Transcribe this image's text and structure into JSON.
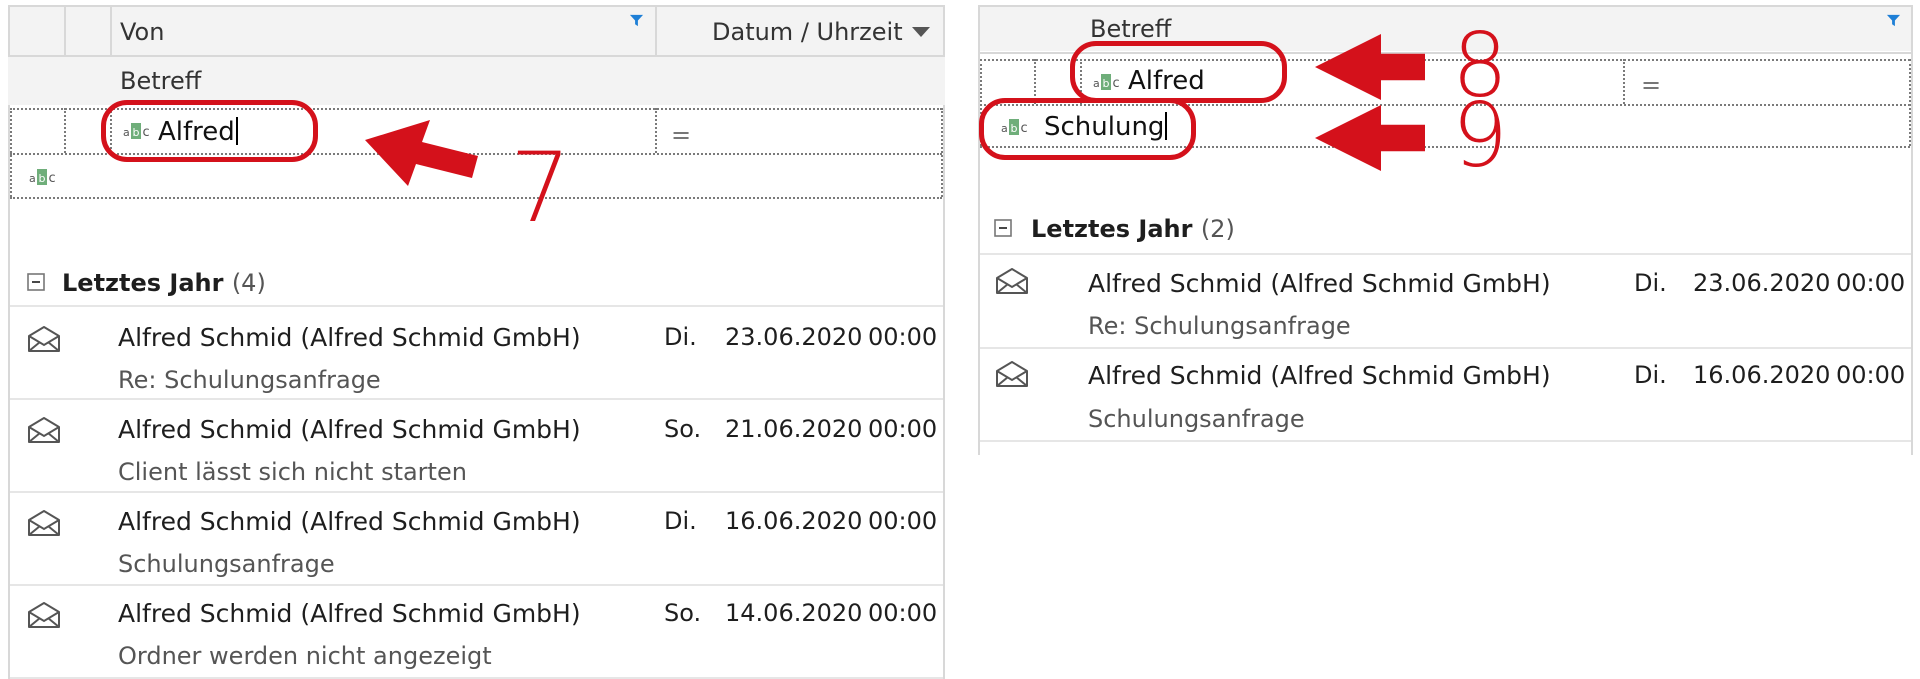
{
  "left": {
    "columns": {
      "from": "Von",
      "date": "Datum / Uhrzeit",
      "subject": "Betreff"
    },
    "filter": {
      "value": "Alfred",
      "operator": "="
    },
    "group": {
      "label": "Letztes Jahr",
      "count": "(4)"
    },
    "rows": [
      {
        "sender": "Alfred Schmid (Alfred Schmid GmbH)",
        "day": "Di.",
        "date": "23.06.2020",
        "time": "00:00",
        "subject": "Re: Schulungsanfrage"
      },
      {
        "sender": "Alfred Schmid (Alfred Schmid GmbH)",
        "day": "So.",
        "date": "21.06.2020",
        "time": "00:00",
        "subject": "Client lässt sich nicht starten"
      },
      {
        "sender": "Alfred Schmid (Alfred Schmid GmbH)",
        "day": "Di.",
        "date": "16.06.2020",
        "time": "00:00",
        "subject": "Schulungsanfrage"
      },
      {
        "sender": "Alfred Schmid (Alfred Schmid GmbH)",
        "day": "So.",
        "date": "14.06.2020",
        "time": "00:00",
        "subject": "Ordner werden nicht angezeigt"
      }
    ]
  },
  "right": {
    "columns": {
      "subject": "Betreff"
    },
    "filter": {
      "from_value": "Alfred",
      "operator": "=",
      "subject_value": "Schulung"
    },
    "group": {
      "label": "Letztes Jahr",
      "count": "(2)"
    },
    "rows": [
      {
        "sender": "Alfred Schmid (Alfred Schmid GmbH)",
        "day": "Di.",
        "date": "23.06.2020",
        "time": "00:00",
        "subject": "Re: Schulungsanfrage"
      },
      {
        "sender": "Alfred Schmid (Alfred Schmid GmbH)",
        "day": "Di.",
        "date": "16.06.2020",
        "time": "00:00",
        "subject": "Schulungsanfrage"
      }
    ]
  },
  "annotations": [
    "7",
    "8",
    "9"
  ],
  "colors": {
    "annotation": "#d4111b",
    "filter_icon": "#1e7fd6",
    "abc_green": "#6fae7a"
  }
}
